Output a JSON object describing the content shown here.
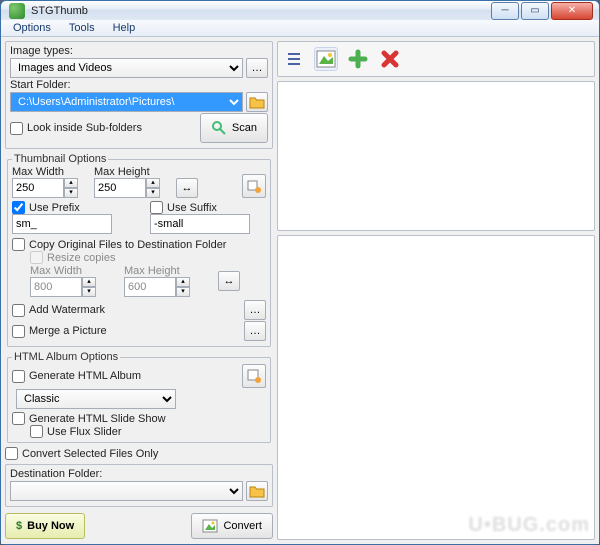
{
  "window": {
    "title": "STGThumb"
  },
  "menu": {
    "options": "Options",
    "tools": "Tools",
    "help": "Help"
  },
  "left": {
    "image_types_label": "Image types:",
    "image_types_value": "Images and Videos",
    "start_folder_label": "Start Folder:",
    "start_folder_value": "C:\\Users\\Administrator\\Pictures\\",
    "look_inside": "Look inside Sub-folders",
    "scan": "Scan",
    "thumb_legend": "Thumbnail Options",
    "max_width_label": "Max Width",
    "max_width_value": "250",
    "max_height_label": "Max Height",
    "max_height_value": "250",
    "use_prefix": "Use Prefix",
    "prefix_value": "sm_",
    "use_suffix": "Use Suffix",
    "suffix_value": "-small",
    "copy_original": "Copy Original Files to Destination Folder",
    "resize_copies": "Resize copies",
    "copy_max_width_label": "Max Width",
    "copy_max_width_value": "800",
    "copy_max_height_label": "Max Height",
    "copy_max_height_value": "600",
    "add_watermark": "Add Watermark",
    "merge_picture": "Merge a Picture",
    "html_legend": "HTML Album Options",
    "gen_album": "Generate HTML Album",
    "album_style": "Classic",
    "gen_slideshow": "Generate HTML Slide Show",
    "use_flux": "Use Flux Slider",
    "convert_selected": "Convert Selected Files Only",
    "dest_folder_label": "Destination Folder:",
    "dest_folder_value": "",
    "buy_now": "Buy Now",
    "convert": "Convert"
  }
}
